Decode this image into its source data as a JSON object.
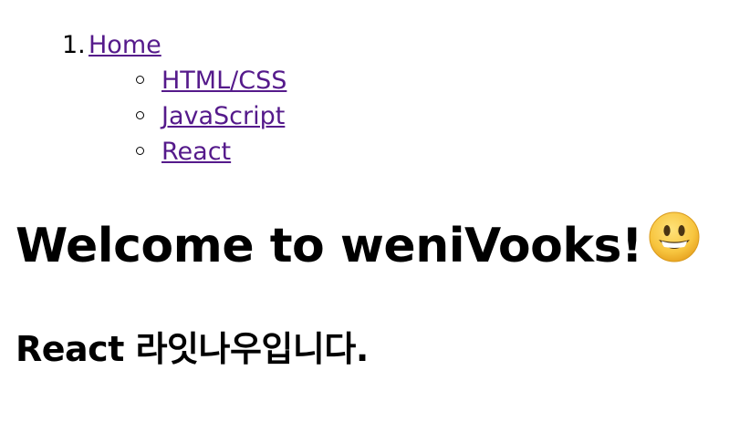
{
  "nav": {
    "home": {
      "number": "1.",
      "label": "Home"
    },
    "subitems": [
      {
        "label": "HTML/CSS"
      },
      {
        "label": "JavaScript"
      },
      {
        "label": "React"
      }
    ]
  },
  "main": {
    "title": "Welcome to weniVooks!",
    "title_emoji": "grinning-face-icon",
    "subtitle": "React 라잇나우입니다."
  },
  "colors": {
    "link": "#551a8b",
    "text": "#000000",
    "background": "#ffffff",
    "emoji_face": "#f7c53f"
  }
}
